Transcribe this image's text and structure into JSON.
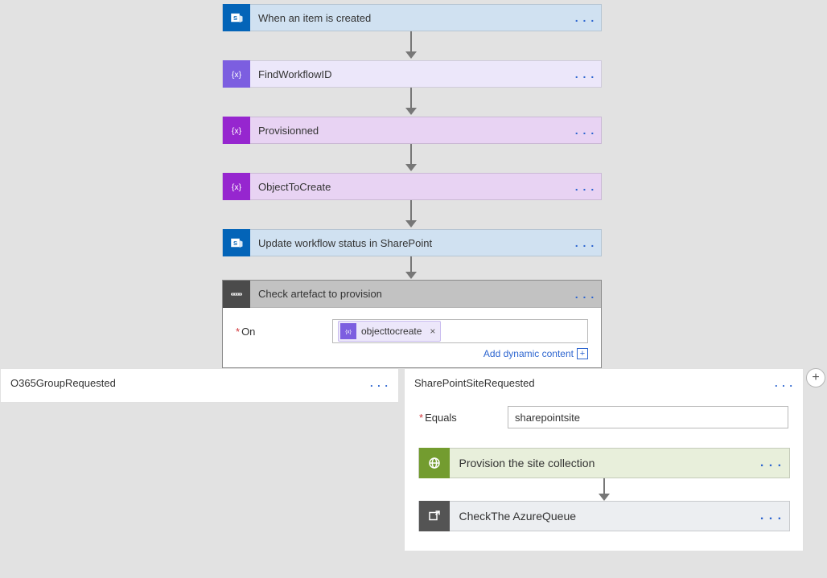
{
  "steps": {
    "trigger": {
      "title": "When an item is created"
    },
    "findwf": {
      "title": "FindWorkflowID"
    },
    "prov": {
      "title": "Provisionned"
    },
    "obj": {
      "title": "ObjectToCreate"
    },
    "update": {
      "title": "Update workflow status in SharePoint"
    }
  },
  "switch": {
    "title": "Check artefact to provision",
    "on_label": "On",
    "token": "objecttocreate",
    "dynamic_link": "Add dynamic content"
  },
  "cases": {
    "left": {
      "title": "O365GroupRequested"
    },
    "right": {
      "title": "SharePointSiteRequested",
      "equals_label": "Equals",
      "equals_value": "sharepointsite",
      "actions": {
        "provision": {
          "title": "Provision the site collection"
        },
        "queue": {
          "title": "CheckThe AzureQueue"
        }
      }
    }
  },
  "menu_dots": ". . ."
}
